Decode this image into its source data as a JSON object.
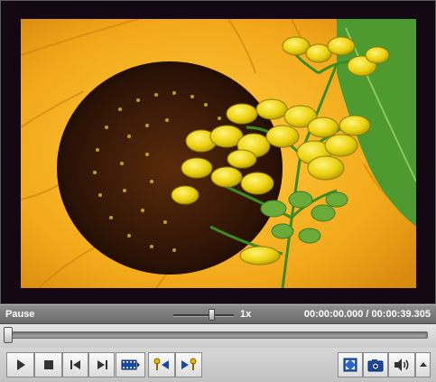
{
  "status": {
    "state_label": "Pause",
    "speed_label": "1x",
    "speed_level": 0.65,
    "time_current": "00:00:00.000",
    "time_separator": "/",
    "time_total": "00:00:39.305"
  },
  "seek": {
    "position_fraction": 0.0
  },
  "toolbar": {
    "icons": [
      "play-icon",
      "stop-icon",
      "previous-frame-icon",
      "next-frame-icon",
      "filmstrip-icon",
      "mark-in-icon",
      "mark-out-icon",
      "fullscreen-icon",
      "snapshot-icon",
      "volume-icon",
      "dropdown-arrow-icon"
    ]
  },
  "colors": {
    "video_background": "#140815",
    "status_text": "#ffffff",
    "accent_icon": "#1a4aa0",
    "marker_yellow": "#e8b800"
  }
}
